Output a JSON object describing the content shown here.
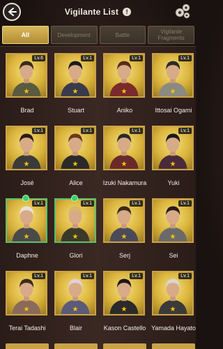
{
  "header": {
    "title": "Vigilante List",
    "info": "!"
  },
  "tabs": [
    {
      "label": "All",
      "active": true
    },
    {
      "label": "Development",
      "active": false
    },
    {
      "label": "Battle",
      "active": false
    },
    {
      "label": "Vigilante Fragments",
      "active": false
    }
  ],
  "characters": [
    {
      "name": "Brad",
      "level": "Lv.6",
      "stars": "★",
      "frame": "gold"
    },
    {
      "name": "Stuart",
      "level": "Lv.1",
      "stars": "★",
      "frame": "gold"
    },
    {
      "name": "Aniko",
      "level": "Lv.1",
      "stars": "★",
      "frame": "gold"
    },
    {
      "name": "Ittosai Ogami",
      "level": "Lv.1",
      "stars": "★",
      "frame": "gold"
    },
    {
      "name": "José",
      "level": "Lv.1",
      "stars": "★",
      "frame": "gold"
    },
    {
      "name": "Alice",
      "level": "Lv.1",
      "stars": "★",
      "frame": "gold"
    },
    {
      "name": "Izuki Nakamura",
      "level": "Lv.1",
      "stars": "★",
      "frame": "gold"
    },
    {
      "name": "Yuki",
      "level": "Lv.1",
      "stars": "★",
      "frame": "gold"
    },
    {
      "name": "Daphne",
      "level": "Lv.1",
      "stars": "★",
      "frame": "green"
    },
    {
      "name": "Glori",
      "level": "Lv.1",
      "stars": "★",
      "frame": "green"
    },
    {
      "name": "Serj",
      "level": "Lv.1",
      "stars": "★",
      "frame": "gold"
    },
    {
      "name": "Sei",
      "level": "Lv.1",
      "stars": "★",
      "frame": "gold"
    },
    {
      "name": "Terai Tadashi",
      "level": "Lv.1",
      "stars": "★",
      "frame": "gold"
    },
    {
      "name": "Blair",
      "level": "Lv.1",
      "stars": "★",
      "frame": "gold"
    },
    {
      "name": "Kason Castello",
      "level": "Lv.1",
      "stars": "★",
      "frame": "gold"
    },
    {
      "name": "Yamada Hayato",
      "level": "Lv.1",
      "stars": "★",
      "frame": "gold"
    }
  ],
  "colors": {
    "gold_frame": "#caa24a",
    "green_frame": "#5ac070",
    "star": "#f5c400",
    "active_tab": "#d9b85a"
  },
  "icons": {
    "back": "back-arrow-icon",
    "settings": "gear-icon",
    "info": "info-icon"
  }
}
